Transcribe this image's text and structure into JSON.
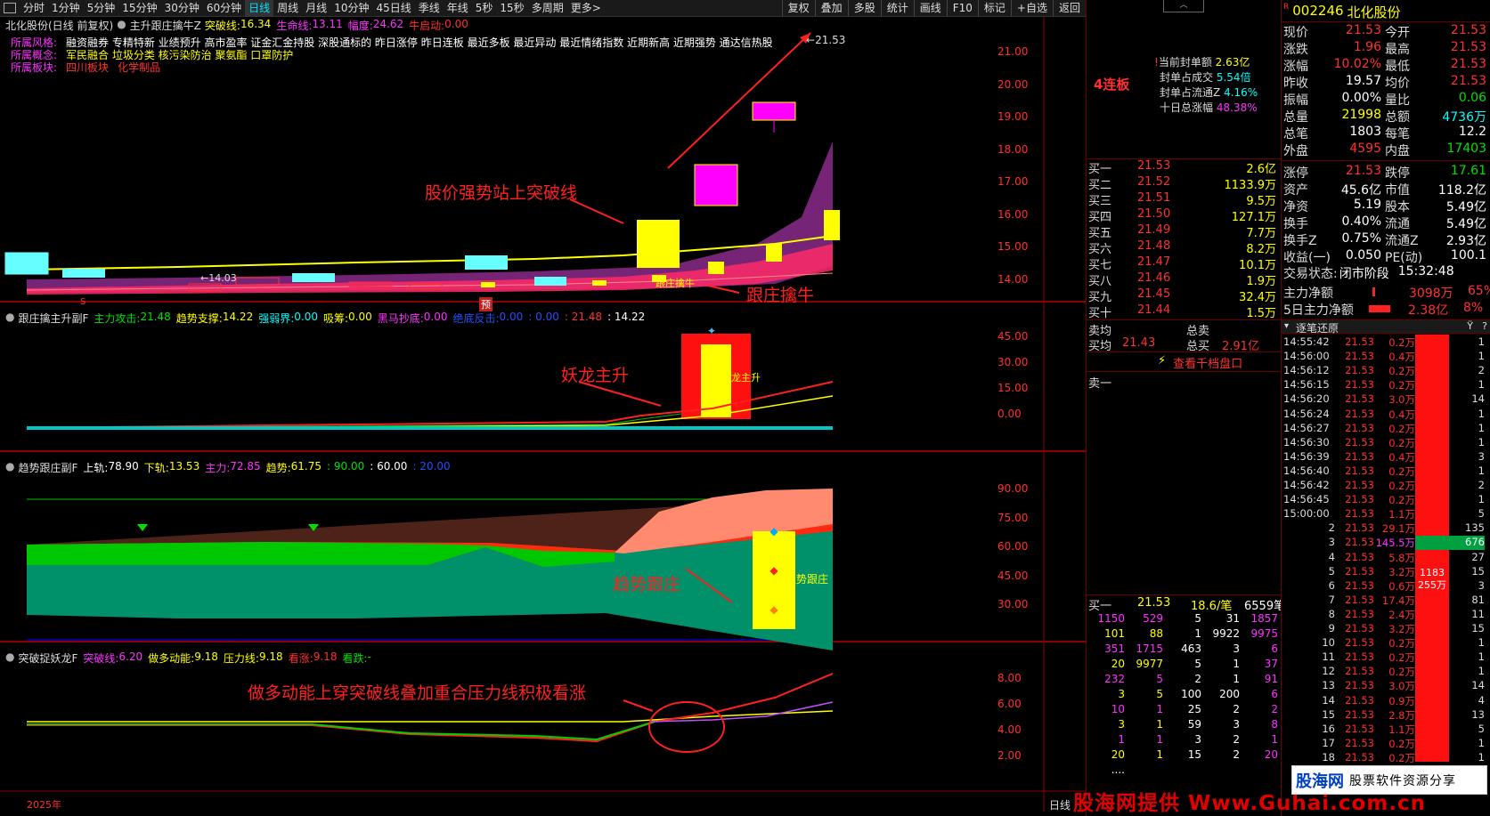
{
  "toolbar": {
    "periods": [
      "分时",
      "1分钟",
      "5分钟",
      "15分钟",
      "30分钟",
      "60分钟",
      "日线",
      "周线",
      "月线",
      "10分钟",
      "45日线",
      "季线",
      "年线",
      "5秒",
      "15秒",
      "多周期",
      "更多>"
    ],
    "active_period": "日线",
    "right_buttons": [
      "复权",
      "叠加",
      "多股",
      "统计",
      "画线",
      "F10",
      "标记",
      "+自选",
      "返回"
    ]
  },
  "main_panel": {
    "title": "北化股份(日线 前复权)",
    "indicator": "主升跟庄擒牛Z",
    "tupo_label": "突破线:",
    "tupo_value": "16.34",
    "shengming_label": "生命线:",
    "shengming_value": "13.11",
    "fudu_label": "幅度:",
    "fudu_value": "24.62",
    "niu_label": "牛启动:",
    "niu_value": "0.00",
    "styles_label": "所属风格:",
    "styles": "融资融券 专精特新 业绩预升 高市盈率 证金汇金持股 深股通标的 昨日涨停 昨日连板 最近多板 最近异动 最近情绪指数 近期新高 近期强势 通达信热股",
    "concepts_label": "所属概念:",
    "concepts": "军民融合 垃圾分类 核污染防治 聚氨酯 口罩防护",
    "sector_label": "所属板块:",
    "sector_a": "四川板块",
    "sector_b": "化学制品",
    "high_mark": "21.53",
    "low_mark": "14.03",
    "annotation1": "股价强势站上突破线",
    "annotation2": "跟庄擒牛",
    "label_gzqn": "跟庄擒牛",
    "badge_yu": "预",
    "badge_s": "S",
    "y_ticks": [
      "21.00",
      "20.00",
      "19.00",
      "18.00",
      "17.00",
      "16.00",
      "15.00",
      "14.00"
    ]
  },
  "panel2": {
    "title": "跟庄擒主升副F",
    "attack_label": "主力攻击:",
    "attack": "21.48",
    "trend_label": "趋势支撑:",
    "trend": "14.22",
    "strong_label": "强弱界:",
    "strong": "0.00",
    "absorb_label": "吸筹:",
    "absorb": "0.00",
    "horse_label": "黑马抄底:",
    "horse": "0.00",
    "bottom_label": "绝底反击:",
    "bottom": "0.00",
    "v1": ": 0.00",
    "v2": ": 21.48",
    "v3": ": 14.22",
    "annotation": "妖龙主升",
    "label_main": "妖龙主升",
    "y_ticks": [
      "45.00",
      "30.00",
      "15.00",
      "0.00"
    ]
  },
  "panel3": {
    "title": "趋势跟庄副F",
    "up_label": "上轨:",
    "up": "78.90",
    "down_label": "下轨:",
    "down": "13.53",
    "main_label": "主力:",
    "main": "72.85",
    "trend_label": "趋势:",
    "trend": "61.75",
    "v1": ": 90.00",
    "v2": ": 60.00",
    "v3": ": 20.00",
    "annotation": "趋势跟庄",
    "label_tr": "趋势跟庄",
    "y_ticks": [
      "90.00",
      "75.00",
      "60.00",
      "45.00",
      "30.00"
    ]
  },
  "panel4": {
    "title": "突破捉妖龙F",
    "tupo_label": "突破线:",
    "tupo": "6.20",
    "duo_label": "做多动能:",
    "duo": "9.18",
    "press_label": "压力线:",
    "press": "9.18",
    "zhang_label": "看涨:",
    "zhang": "9.18",
    "die_label": "看跌:",
    "die": "-",
    "annotation": "做多动能上穿突破线叠加重合压力线积极看涨",
    "y_ticks": [
      "8.00",
      "6.00",
      "4.00",
      "2.00"
    ]
  },
  "footer": {
    "year": "2025年",
    "period": "日线"
  },
  "board": {
    "lianban": "4连板",
    "seal_amount_label": "当前封单额",
    "seal_amount": "2.63亿",
    "seal_deal_label": "封单占成交",
    "seal_deal": "5.54倍",
    "seal_float_label": "封单占流通Z",
    "seal_float": "4.16%",
    "ten_day_label": "十日总涨幅",
    "ten_day": "48.38%"
  },
  "orderbook": {
    "buys": [
      {
        "l": "买一",
        "p": "21.53",
        "v": "2.6亿"
      },
      {
        "l": "买二",
        "p": "21.52",
        "v": "1133.9万"
      },
      {
        "l": "买三",
        "p": "21.51",
        "v": "9.5万"
      },
      {
        "l": "买四",
        "p": "21.50",
        "v": "127.1万"
      },
      {
        "l": "买五",
        "p": "21.49",
        "v": "7.7万"
      },
      {
        "l": "买六",
        "p": "21.48",
        "v": "8.2万"
      },
      {
        "l": "买七",
        "p": "21.47",
        "v": "10.1万"
      },
      {
        "l": "买八",
        "p": "21.46",
        "v": "1.9万"
      },
      {
        "l": "买九",
        "p": "21.45",
        "v": "32.4万"
      },
      {
        "l": "买十",
        "p": "21.44",
        "v": "1.5万"
      }
    ],
    "sell_avg_label": "卖均",
    "sell_total_label": "总卖",
    "buy_avg_label": "买均",
    "buy_avg": "21.43",
    "buy_total_label": "总买",
    "buy_total": "2.91亿",
    "view_ten": "查看千档盘口",
    "sell_one": "卖一",
    "b1_label": "买一",
    "b1_price": "21.53",
    "b1_per": "18.6/笔",
    "b1_count": "6559笔",
    "queue": [
      [
        "1150",
        "529",
        "5",
        "31",
        "1857"
      ],
      [
        "101",
        "88",
        "1",
        "9922",
        "9975"
      ],
      [
        "351",
        "1715",
        "463",
        "3",
        "6"
      ],
      [
        "20",
        "9977",
        "5",
        "1",
        "37"
      ],
      [
        "232",
        "5",
        "2",
        "1",
        "91"
      ],
      [
        "3",
        "5",
        "100",
        "200",
        "6"
      ],
      [
        "10",
        "1",
        "25",
        "2",
        "2"
      ],
      [
        "3",
        "1",
        "59",
        "3",
        "8"
      ],
      [
        "1",
        "1",
        "3",
        "2",
        "1"
      ],
      [
        "20",
        "1",
        "15",
        "2",
        "20"
      ],
      [
        "....",
        "",
        "",
        "",
        ""
      ]
    ]
  },
  "quote": {
    "r": "R",
    "code": "002246",
    "name": "北化股份",
    "rows": [
      [
        "现价",
        "21.53",
        "今开",
        "21.53"
      ],
      [
        "涨跌",
        "1.96",
        "最高",
        "21.53"
      ],
      [
        "涨幅",
        "10.02%",
        "最低",
        "21.53"
      ],
      [
        "昨收",
        "19.57",
        "均价",
        "21.53"
      ],
      [
        "振幅",
        "0.00%",
        "量比",
        "0.06"
      ],
      [
        "总量",
        "21998",
        "总额",
        "4736万"
      ],
      [
        "总笔",
        "1803",
        "每笔",
        "12.2"
      ],
      [
        "外盘",
        "4595",
        "内盘",
        "17403"
      ],
      [
        "涨停",
        "21.53",
        "跌停",
        "17.61"
      ],
      [
        "资产",
        "45.6亿",
        "市值",
        "118.2亿"
      ],
      [
        "净资",
        "5.19",
        "股本",
        "5.49亿"
      ],
      [
        "换手",
        "0.40%",
        "流通",
        "5.49亿"
      ],
      [
        "换手Z",
        "0.75%",
        "流通Z",
        "2.93亿"
      ],
      [
        "收益(一)",
        "0.050",
        "PE(动)",
        "100.1"
      ]
    ],
    "status_label": "交易状态:",
    "status": "闭市阶段",
    "time": "15:32:48",
    "net_label": "主力净额",
    "net_val": "3098万",
    "net_pct": "65%",
    "net5_label": "5日主力净额",
    "net5_val": "2.38亿",
    "net5_pct": "8%",
    "trades_title": "逐笔还原",
    "trades": [
      [
        "14:55:42",
        "21.53",
        "0.2万",
        "1"
      ],
      [
        "14:56:00",
        "21.53",
        "0.4万",
        "1"
      ],
      [
        "14:56:12",
        "21.53",
        "0.2万",
        "2"
      ],
      [
        "14:56:15",
        "21.53",
        "0.2万",
        "1"
      ],
      [
        "14:56:20",
        "21.53",
        "3.0万",
        "14"
      ],
      [
        "14:56:24",
        "21.53",
        "0.4万",
        "1"
      ],
      [
        "14:56:27",
        "21.53",
        "0.2万",
        "1"
      ],
      [
        "14:56:30",
        "21.53",
        "0.2万",
        "1"
      ],
      [
        "14:56:39",
        "21.53",
        "0.4万",
        "3"
      ],
      [
        "14:56:40",
        "21.53",
        "0.2万",
        "1"
      ],
      [
        "14:56:42",
        "21.53",
        "0.2万",
        "2"
      ],
      [
        "14:56:45",
        "21.53",
        "0.2万",
        "1"
      ],
      [
        "15:00:00",
        "21.53",
        "1.1万",
        "5"
      ],
      [
        "2",
        "21.53",
        "29.1万",
        "135"
      ],
      [
        "3",
        "21.53",
        "145.5万",
        "676"
      ],
      [
        "4",
        "21.53",
        "5.8万",
        "27"
      ],
      [
        "5",
        "21.53",
        "3.2万",
        "15"
      ],
      [
        "6",
        "21.53",
        "0.6万",
        "3"
      ],
      [
        "7",
        "21.53",
        "17.4万",
        "81"
      ],
      [
        "8",
        "21.53",
        "2.4万",
        "11"
      ],
      [
        "9",
        "21.53",
        "3.2万",
        "15"
      ],
      [
        "10",
        "21.53",
        "0.2万",
        "1"
      ],
      [
        "11",
        "21.53",
        "0.2万",
        "1"
      ],
      [
        "12",
        "21.53",
        "0.2万",
        "1"
      ],
      [
        "13",
        "21.53",
        "3.0万",
        "14"
      ],
      [
        "14",
        "21.53",
        "0.9万",
        "4"
      ],
      [
        "15",
        "21.53",
        "2.8万",
        "13"
      ],
      [
        "16",
        "21.53",
        "1.1万",
        "5"
      ],
      [
        "17",
        "21.53",
        "0.2万",
        "1"
      ],
      [
        "18",
        "21.53",
        "0.2万",
        "1"
      ]
    ],
    "bar_val1": "1183",
    "bar_val2": "255万"
  },
  "watermark": {
    "text": "股海网提供 Www.Guhai.com.cn",
    "logo": "股海网",
    "slogan": "股票软件资源分享"
  }
}
